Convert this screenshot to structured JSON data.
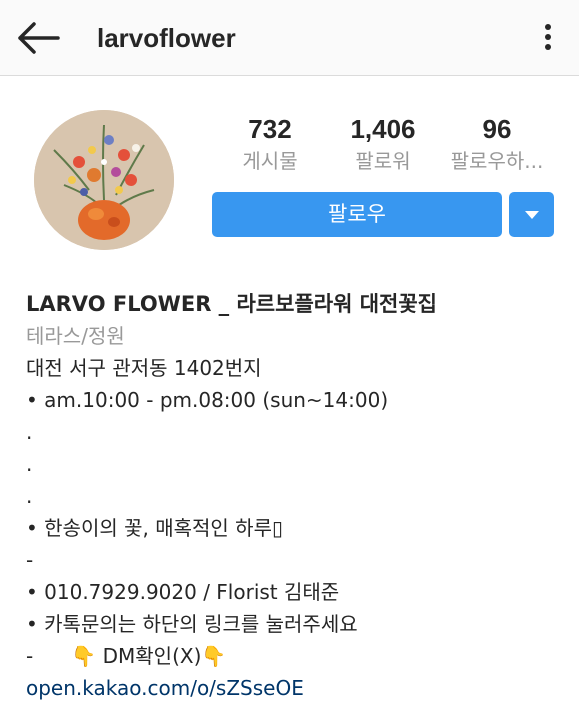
{
  "header": {
    "username": "larvoflower",
    "back_icon": "arrow-left-icon",
    "more_icon": "more-vertical-icon"
  },
  "stats": [
    {
      "value": "732",
      "label": "게시물"
    },
    {
      "value": "1,406",
      "label": "팔로워"
    },
    {
      "value": "96",
      "label": "팔로우하..."
    }
  ],
  "actions": {
    "follow_label": "팔로우",
    "dropdown_icon": "caret-down-icon"
  },
  "bio": {
    "name": "LARVO FLOWER _ 라르보플라워 대전꽃집",
    "category": "테라스/정원",
    "lines": [
      "대전 서구 관저동 1402번지",
      "• am.10:00 - pm.08:00 (sun~14:00)",
      ".",
      ".",
      ".",
      "• 한송이의 꽃, 매혹적인 하루▯",
      "-",
      "• 010.7929.9020 / Florist 김태준",
      "• 카톡문의는 하단의 링크를 눌러주세요",
      "-      👇 DM확인(X)👇"
    ],
    "link": "open.kakao.com/o/sZSseOE"
  },
  "colors": {
    "accent": "#3897f0",
    "link": "#003569",
    "muted": "#999999",
    "text": "#262626"
  }
}
